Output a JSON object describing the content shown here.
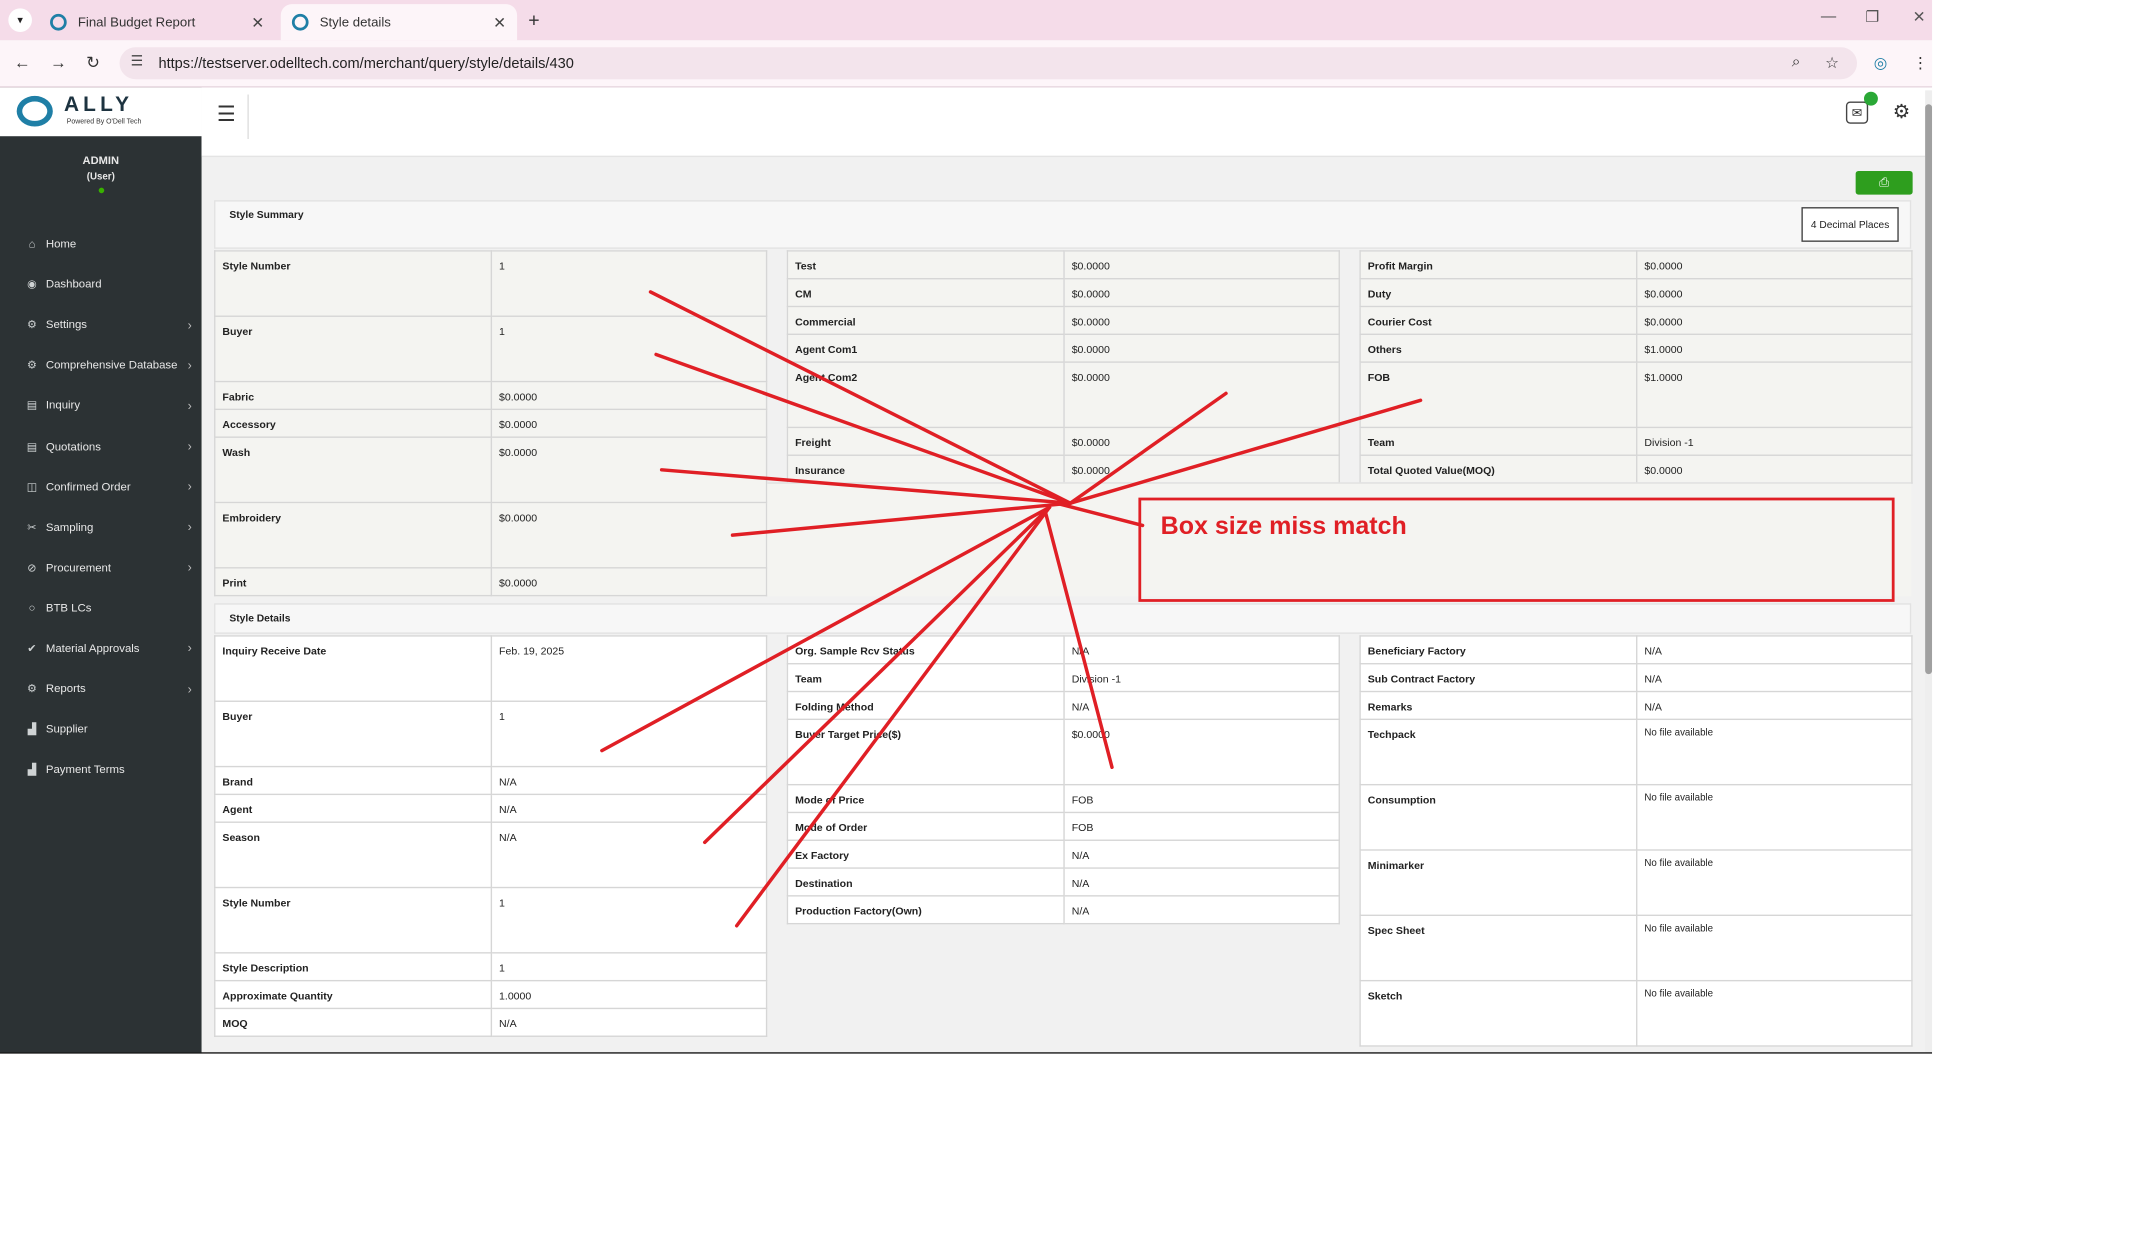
{
  "browser": {
    "tabs": [
      {
        "title": "Final Budget Report",
        "active": false
      },
      {
        "title": "Style details",
        "active": true
      }
    ],
    "url": "https://testserver.odelltech.com/merchant/query/style/details/430"
  },
  "brand": {
    "name": "ALLY",
    "tagline": "Powered By O'Dell Tech",
    "accent": "#1f7fa6"
  },
  "user": {
    "name": "ADMIN",
    "role": "(User)"
  },
  "sidebar": {
    "items": [
      {
        "label": "Home",
        "icon": "home-icon",
        "glyph": "⌂",
        "chevron": false
      },
      {
        "label": "Dashboard",
        "icon": "dashboard-icon",
        "glyph": "◉",
        "chevron": false
      },
      {
        "label": "Settings",
        "icon": "gear-icon",
        "glyph": "⚙",
        "chevron": true
      },
      {
        "label": "Comprehensive Database",
        "icon": "gear-icon",
        "glyph": "⚙",
        "chevron": true
      },
      {
        "label": "Inquiry",
        "icon": "file-icon",
        "glyph": "▤",
        "chevron": true
      },
      {
        "label": "Quotations",
        "icon": "file-icon",
        "glyph": "▤",
        "chevron": true
      },
      {
        "label": "Confirmed Order",
        "icon": "columns-icon",
        "glyph": "◫",
        "chevron": true
      },
      {
        "label": "Sampling",
        "icon": "scissors-icon",
        "glyph": "✂",
        "chevron": true
      },
      {
        "label": "Procurement",
        "icon": "ban-icon",
        "glyph": "⊘",
        "chevron": true
      },
      {
        "label": "BTB LCs",
        "icon": "circle-icon",
        "glyph": "○",
        "chevron": false
      },
      {
        "label": "Material Approvals",
        "icon": "check-icon",
        "glyph": "✔",
        "chevron": true
      },
      {
        "label": "Reports",
        "icon": "cog-icon",
        "glyph": "⚙",
        "chevron": true
      },
      {
        "label": "Supplier",
        "icon": "bar-chart-icon",
        "glyph": "▟",
        "chevron": false
      },
      {
        "label": "Payment Terms",
        "icon": "bar-chart-icon",
        "glyph": "▟",
        "chevron": false
      }
    ]
  },
  "toolbar": {
    "decimal_label": "4 Decimal Places"
  },
  "summary": {
    "title": "Style Summary",
    "col1": [
      {
        "k": "Style Number",
        "v": "1",
        "h": 47
      },
      {
        "k": "Buyer",
        "v": "1",
        "h": 47
      },
      {
        "k": "Fabric",
        "v": "$0.0000",
        "h": 20
      },
      {
        "k": "Accessory",
        "v": "$0.0000",
        "h": 20
      },
      {
        "k": "Wash",
        "v": "$0.0000",
        "h": 47
      },
      {
        "k": "Embroidery",
        "v": "$0.0000",
        "h": 47
      },
      {
        "k": "Print",
        "v": "$0.0000",
        "h": 20
      }
    ],
    "col2": [
      {
        "k": "Test",
        "v": "$0.0000",
        "h": 20
      },
      {
        "k": "CM",
        "v": "$0.0000",
        "h": 20
      },
      {
        "k": "Commercial",
        "v": "$0.0000",
        "h": 20
      },
      {
        "k": "Agent Com1",
        "v": "$0.0000",
        "h": 20
      },
      {
        "k": "Agent Com2",
        "v": "$0.0000",
        "h": 47
      },
      {
        "k": "Freight",
        "v": "$0.0000",
        "h": 20
      },
      {
        "k": "Insurance",
        "v": "$0.0000",
        "h": 20
      }
    ],
    "col3": [
      {
        "k": "Profit Margin",
        "v": "$0.0000",
        "h": 20
      },
      {
        "k": "Duty",
        "v": "$0.0000",
        "h": 20
      },
      {
        "k": "Courier Cost",
        "v": "$0.0000",
        "h": 20
      },
      {
        "k": "Others",
        "v": "$1.0000",
        "h": 20
      },
      {
        "k": "FOB",
        "v": "$1.0000",
        "h": 47
      },
      {
        "k": "Team",
        "v": "Division -1",
        "h": 20
      },
      {
        "k": "Total Quoted Value(MOQ)",
        "v": "$0.0000",
        "h": 20
      }
    ]
  },
  "details": {
    "title": "Style Details",
    "col1": [
      {
        "k": "Inquiry Receive Date",
        "v": "Feb. 19, 2025",
        "h": 47
      },
      {
        "k": "Buyer",
        "v": "1",
        "h": 47
      },
      {
        "k": "Brand",
        "v": "N/A",
        "h": 20
      },
      {
        "k": "Agent",
        "v": "N/A",
        "h": 20
      },
      {
        "k": "Season",
        "v": "N/A",
        "h": 47
      },
      {
        "k": "Style Number",
        "v": "1",
        "h": 47
      },
      {
        "k": "Style Description",
        "v": "1",
        "h": 20
      },
      {
        "k": "Approximate Quantity",
        "v": "1.0000",
        "h": 20
      },
      {
        "k": "MOQ",
        "v": "N/A",
        "h": 20
      }
    ],
    "col2": [
      {
        "k": "Org. Sample Rcv Status",
        "v": "N/A",
        "h": 20
      },
      {
        "k": "Team",
        "v": "Division -1",
        "h": 20
      },
      {
        "k": "Folding Method",
        "v": "N/A",
        "h": 20
      },
      {
        "k": "Buyer Target Price($)",
        "v": "$0.0000",
        "h": 47
      },
      {
        "k": "Mode of Price",
        "v": "FOB",
        "h": 20
      },
      {
        "k": "Mode of Order",
        "v": "FOB",
        "h": 20
      },
      {
        "k": "Ex Factory",
        "v": "N/A",
        "h": 20
      },
      {
        "k": "Destination",
        "v": "N/A",
        "h": 20
      },
      {
        "k": "Production Factory(Own)",
        "v": "N/A",
        "h": 20
      }
    ],
    "col3": [
      {
        "k": "Beneficiary Factory",
        "v": "N/A",
        "h": 20
      },
      {
        "k": "Sub Contract Factory",
        "v": "N/A",
        "h": 20
      },
      {
        "k": "Remarks",
        "v": "N/A",
        "h": 20
      },
      {
        "k": "Techpack",
        "v": "No file available",
        "h": 47,
        "nofile": true
      },
      {
        "k": "Consumption",
        "v": "No file available",
        "h": 47,
        "nofile": true
      },
      {
        "k": "Minimarker",
        "v": "No file available",
        "h": 47,
        "nofile": true
      },
      {
        "k": "Spec Sheet",
        "v": "No file available",
        "h": 47,
        "nofile": true
      },
      {
        "k": "Sketch",
        "v": "No file available",
        "h": 47,
        "nofile": true
      }
    ]
  },
  "annotation": {
    "text": "Box size miss match",
    "color": "#e01f25"
  }
}
